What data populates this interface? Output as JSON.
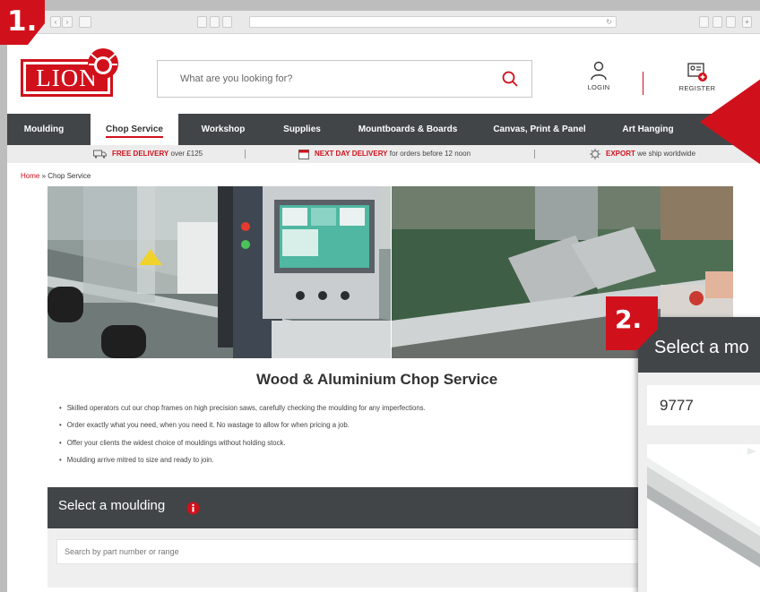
{
  "header": {
    "search_placeholder": "What are you looking for?",
    "login_label": "LOGIN",
    "register_label": "REGISTER"
  },
  "nav": {
    "items": [
      {
        "label": "Moulding"
      },
      {
        "label": "Chop Service",
        "active": true
      },
      {
        "label": "Workshop"
      },
      {
        "label": "Supplies"
      },
      {
        "label": "Mountboards & Boards"
      },
      {
        "label": "Canvas, Print & Panel"
      },
      {
        "label": "Art Hanging"
      }
    ]
  },
  "usp": {
    "delivery_bold": "FREE DELIVERY",
    "delivery_rest": " over £125",
    "nextday_bold": "NEXT DAY DELIVERY",
    "nextday_rest": " for orders before 12 noon",
    "export_bold": "EXPORT",
    "export_rest": " we ship worldwide"
  },
  "breadcrumb": {
    "home": "Home",
    "separator": " » ",
    "current": "Chop Service"
  },
  "main": {
    "title": "Wood & Aluminium Chop Service",
    "bullets": [
      "Skilled operators cut our chop frames on high precision saws, carefully checking the moulding for any imperfections.",
      "Order exactly what you need, when you need it. No wastage to allow for when pricing a job.",
      "Offer your clients the widest choice of mouldings without holding stock.",
      "Moulding arrive mitred to size and ready to join."
    ],
    "select_title": "Select a moulding",
    "select_placeholder": "Search by part number or range"
  },
  "markers": {
    "m1": "1.",
    "m2": "2."
  },
  "zoom": {
    "title": "Select a mo",
    "input_value": "9777"
  },
  "brand": {
    "logo_text": "LION",
    "accent": "#d0111c",
    "dark": "#414548"
  }
}
